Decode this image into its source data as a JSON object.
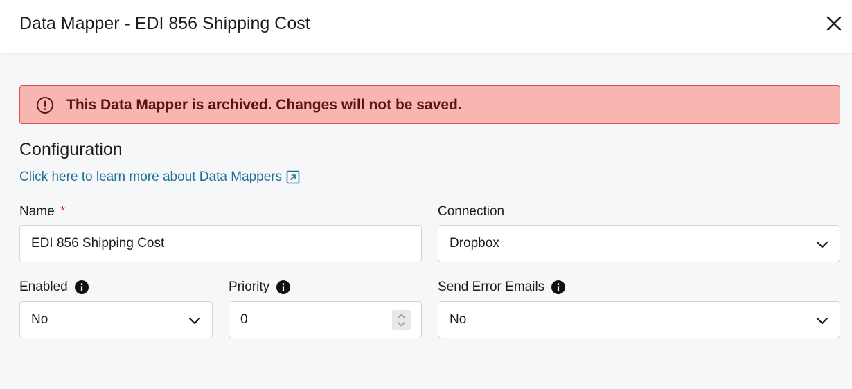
{
  "header": {
    "title": "Data Mapper - EDI 856 Shipping Cost",
    "close_icon": "close-icon"
  },
  "alert": {
    "message": "This Data Mapper is archived. Changes will not be saved.",
    "icon": "alert-circle-icon",
    "background": "#f7b6b2",
    "border": "#d9534f",
    "text_color": "#5b1410"
  },
  "configuration": {
    "title": "Configuration",
    "learn_link": "Click here to learn more about Data Mappers",
    "learn_link_icon": "external-link-icon",
    "link_color": "#1d6f98"
  },
  "fields": {
    "name": {
      "label": "Name",
      "required_marker": "*",
      "value": "EDI 856 Shipping Cost"
    },
    "connection": {
      "label": "Connection",
      "value": "Dropbox"
    },
    "enabled": {
      "label": "Enabled",
      "value": "No"
    },
    "priority": {
      "label": "Priority",
      "value": "0"
    },
    "send_error_emails": {
      "label": "Send Error Emails",
      "value": "No"
    }
  }
}
